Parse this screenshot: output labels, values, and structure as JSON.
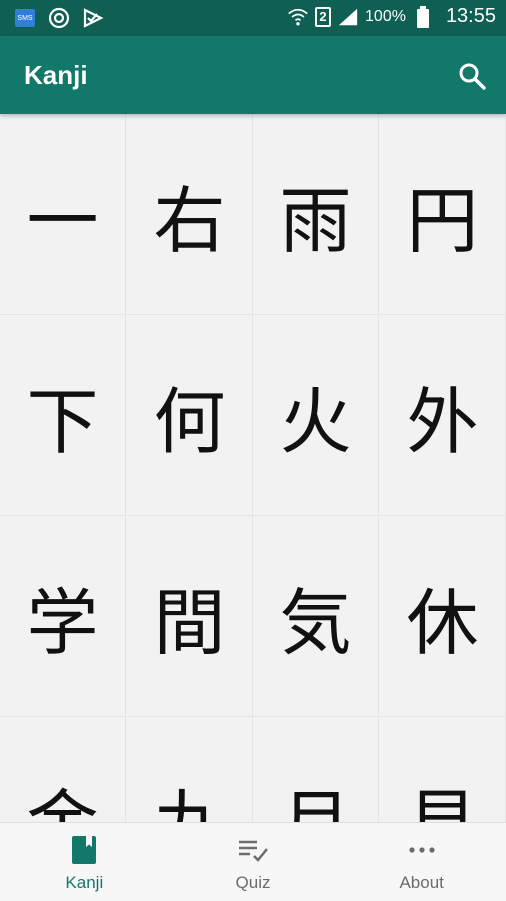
{
  "status_bar": {
    "sms_label": "SMS",
    "sim_slot": "2",
    "battery": "100%",
    "time": "13:55"
  },
  "app_bar": {
    "title": "Kanji",
    "search_icon": "search-icon"
  },
  "kanji_grid": [
    "一",
    "右",
    "雨",
    "円",
    "下",
    "何",
    "火",
    "外",
    "学",
    "間",
    "気",
    "休",
    "金",
    "九",
    "月",
    "見"
  ],
  "bottom_nav": {
    "items": [
      {
        "label": "Kanji",
        "icon": "book-icon",
        "active": true
      },
      {
        "label": "Quiz",
        "icon": "checklist-icon",
        "active": false
      },
      {
        "label": "About",
        "icon": "more-icon",
        "active": false
      }
    ]
  },
  "colors": {
    "status_bar": "#0f5f52",
    "app_bar": "#11786a",
    "accent": "#11786a",
    "inactive": "#6b6b6b"
  }
}
